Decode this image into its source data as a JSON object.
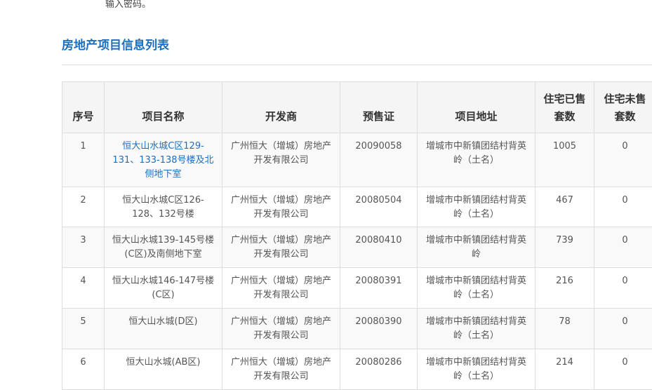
{
  "top_note": "输入密码。",
  "section_title": "房地产项目信息列表",
  "table": {
    "headers": [
      "序号",
      "项目名称",
      "开发商",
      "预售证",
      "项目地址",
      "住宅已售套数",
      "住宅未售套数"
    ],
    "headers_display": {
      "sold": [
        "住宅已售",
        "套数"
      ],
      "unsold": [
        "住宅未售",
        "套数"
      ]
    },
    "rows": [
      {
        "no": "1",
        "name": "恒大山水城C区129-131、133-138号楼及北侧地下室",
        "developer": "广州恒大（增城）房地产开发有限公司",
        "permit": "20090058",
        "address": "增城市中新镇团结村背英岭（土名）",
        "sold": "1005",
        "unsold": "0",
        "name_is_link": true
      },
      {
        "no": "2",
        "name": "恒大山水城C区126-128、132号楼",
        "developer": "广州恒大（增城）房地产开发有限公司",
        "permit": "20080504",
        "address": "增城市中新镇团结村背英岭（土名）",
        "sold": "467",
        "unsold": "0"
      },
      {
        "no": "3",
        "name": "恒大山水城139-145号楼(C区)及南侧地下室",
        "developer": "广州恒大（增城）房地产开发有限公司",
        "permit": "20080410",
        "address": "增城市中新镇团结村背英岭",
        "sold": "739",
        "unsold": "0"
      },
      {
        "no": "4",
        "name": "恒大山水城146-147号楼(C区)",
        "developer": "广州恒大（增城）房地产开发有限公司",
        "permit": "20080391",
        "address": "增城市中新镇团结村背英岭（土名）",
        "sold": "216",
        "unsold": "0"
      },
      {
        "no": "5",
        "name": "恒大山水城(D区)",
        "developer": "广州恒大（增城）房地产开发有限公司",
        "permit": "20080390",
        "address": "增城市中新镇团结村背英岭（土名）",
        "sold": "78",
        "unsold": "0"
      },
      {
        "no": "6",
        "name": "恒大山水城(AB区)",
        "developer": "广州恒大（增城）房地产开发有限公司",
        "permit": "20080286",
        "address": "增城市中新镇团结村背英岭（土名）",
        "sold": "214",
        "unsold": "0"
      }
    ]
  },
  "colors": {
    "accent": "#1c6fbe",
    "border": "#dddddd",
    "header_bg": "#f5f5f5"
  }
}
